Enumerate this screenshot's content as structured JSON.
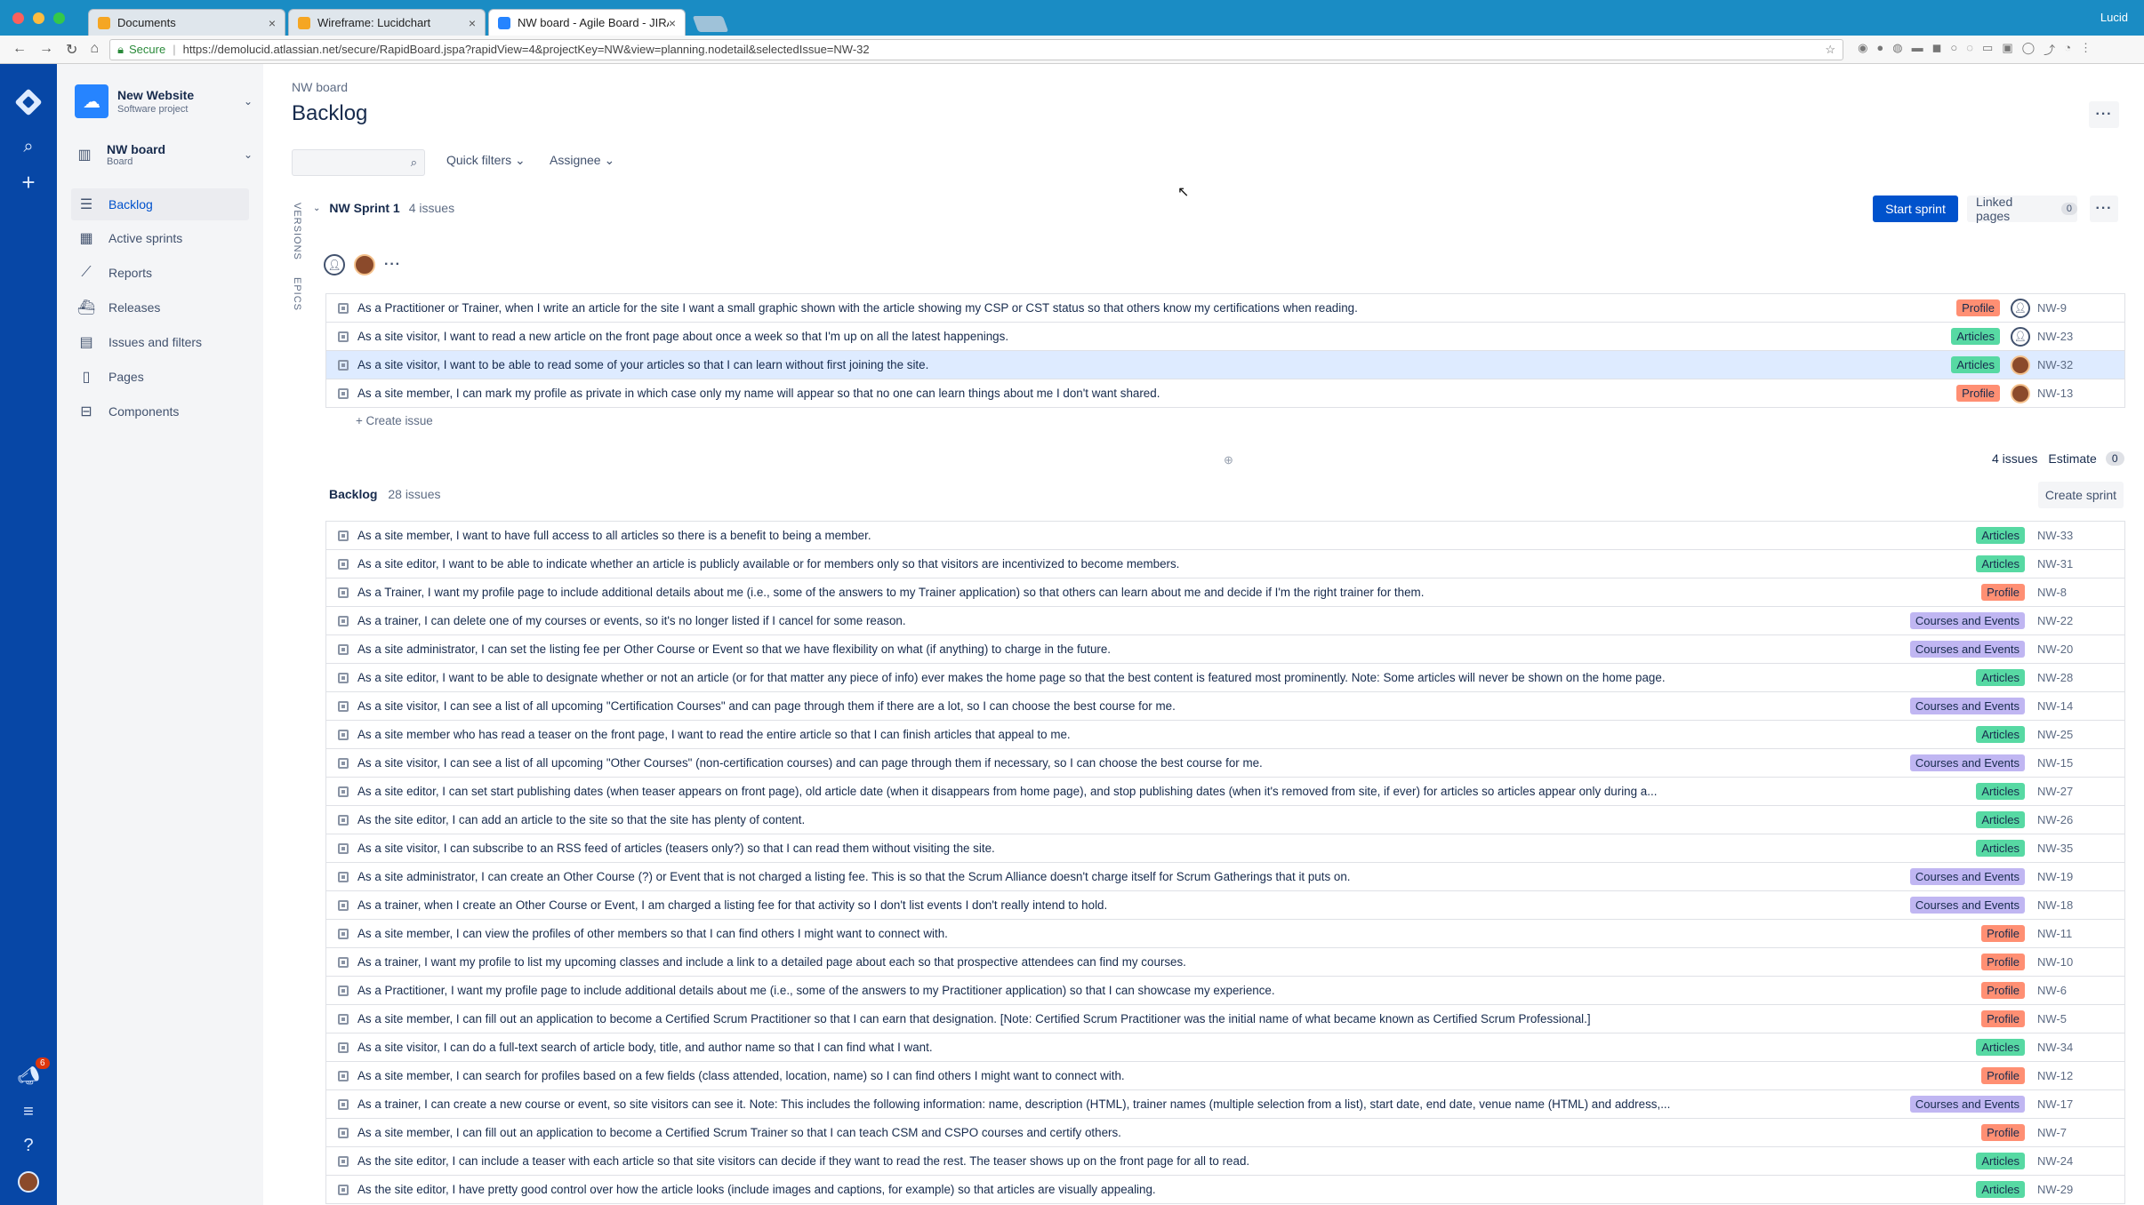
{
  "browser": {
    "tabs": [
      {
        "title": "Documents",
        "favicon_color": "#f5a623",
        "active": false
      },
      {
        "title": "Wireframe: Lucidchart",
        "favicon_color": "#f5a623",
        "active": false
      },
      {
        "title": "NW board - Agile Board - JIRA",
        "favicon_color": "#2684ff",
        "active": true
      }
    ],
    "profile": "Lucid",
    "secure_label": "Secure",
    "url": "https://demolucid.atlassian.net/secure/RapidBoard.jspa?rapidView=4&projectKey=NW&view=planning.nodetail&selectedIssue=NW-32"
  },
  "global_nav": {
    "notification_count": "6"
  },
  "project": {
    "name": "New Website",
    "type": "Software project",
    "board_name": "NW board",
    "board_type": "Board",
    "nav": [
      "Backlog",
      "Active sprints",
      "Reports",
      "Releases",
      "Issues and filters",
      "Pages",
      "Components"
    ]
  },
  "header": {
    "breadcrumb": "NW board",
    "title": "Backlog",
    "quick_filters": "Quick filters",
    "assignee": "Assignee"
  },
  "side_tabs": {
    "versions": "VERSIONS",
    "epics": "EPICS"
  },
  "sprint": {
    "name": "NW Sprint 1",
    "count": "4 issues",
    "start_label": "Start sprint",
    "linked_pages_label": "Linked pages",
    "linked_pages_count": "0",
    "create_issue": "+ Create issue",
    "summary_count": "4 issues",
    "estimate_label": "Estimate",
    "estimate_value": "0",
    "issues": [
      {
        "summary": "As a Practitioner or Trainer, when I write an article for the site I want a small graphic shown with the article showing my CSP or CST status so that others know my certifications when reading.",
        "epic": "Profile",
        "assignee": "user",
        "key": "NW-9"
      },
      {
        "summary": "As a site visitor, I want to read a new article on the front page about once a week so that I'm up on all the latest happenings.",
        "epic": "Articles",
        "assignee": "user",
        "key": "NW-23"
      },
      {
        "summary": "As a site visitor, I want to be able to read some of your articles so that I can learn without first joining the site.",
        "epic": "Articles",
        "assignee": "face",
        "key": "NW-32"
      },
      {
        "summary": "As a site member, I can mark my profile as private in which case only my name will appear so that no one can learn things about me I don't want shared.",
        "epic": "Profile",
        "assignee": "face",
        "key": "NW-13"
      }
    ]
  },
  "backlog": {
    "name": "Backlog",
    "count": "28 issues",
    "create_sprint_label": "Create sprint",
    "issues": [
      {
        "summary": "As a site member, I want to have full access to all articles so there is a benefit to being a member.",
        "epic": "Articles",
        "key": "NW-33"
      },
      {
        "summary": "As a site editor, I want to be able to indicate whether an article is publicly available or for members only so that visitors are incentivized to become members.",
        "epic": "Articles",
        "key": "NW-31"
      },
      {
        "summary": "As a Trainer, I want my profile page to include additional details about me (i.e., some of the answers to my Trainer application) so that others can learn about me and decide if I'm the right trainer for them.",
        "epic": "Profile",
        "key": "NW-8"
      },
      {
        "summary": "As a trainer, I can delete one of my courses or events, so it's no longer listed if I cancel for some reason.",
        "epic": "Courses and Events",
        "key": "NW-22"
      },
      {
        "summary": "As a site administrator, I can set the listing fee per Other Course or Event so that we have flexibility on what (if anything) to charge in the future.",
        "epic": "Courses and Events",
        "key": "NW-20"
      },
      {
        "summary": "As a site editor, I want to be able to designate whether or not an article (or for that matter any piece of info) ever makes the home page so that the best content is featured most prominently. Note: Some articles will never be shown on the home page.",
        "epic": "Articles",
        "key": "NW-28"
      },
      {
        "summary": "As a site visitor, I can see a list of all upcoming \"Certification Courses\" and can page through them if there are a lot, so I can choose the best course for me.",
        "epic": "Courses and Events",
        "key": "NW-14"
      },
      {
        "summary": "As a site member who has read a teaser on the front page, I want to read the entire article so that I can finish articles that appeal to me.",
        "epic": "Articles",
        "key": "NW-25"
      },
      {
        "summary": "As a site visitor, I can see a list of all upcoming \"Other Courses\" (non-certification courses) and can page through them if necessary, so I can choose the best course for me.",
        "epic": "Courses and Events",
        "key": "NW-15"
      },
      {
        "summary": "As a site editor, I can set start publishing dates (when teaser appears on front page), old article date (when it disappears from home page), and stop publishing dates (when it's removed from site, if ever) for articles so articles appear only during a...",
        "epic": "Articles",
        "key": "NW-27"
      },
      {
        "summary": "As the site editor, I can add an article to the site so that the site has plenty of content.",
        "epic": "Articles",
        "key": "NW-26"
      },
      {
        "summary": "As a site visitor, I can subscribe to an RSS feed of articles (teasers only?) so that I can read them without visiting the site.",
        "epic": "Articles",
        "key": "NW-35"
      },
      {
        "summary": "As a site administrator, I can create an Other Course (?) or Event that is not charged a listing fee. This is so that the Scrum Alliance doesn't charge itself for Scrum Gatherings that it puts on.",
        "epic": "Courses and Events",
        "key": "NW-19"
      },
      {
        "summary": "As a trainer, when I create an Other Course or Event, I am charged a listing fee for that activity so I don't list events I don't really intend to hold.",
        "epic": "Courses and Events",
        "key": "NW-18"
      },
      {
        "summary": "As a site member, I can view the profiles of other members so that I can find others I might want to connect with.",
        "epic": "Profile",
        "key": "NW-11"
      },
      {
        "summary": "As a trainer, I want my profile to list my upcoming classes and include a link to a detailed page about each so that prospective attendees can find my courses.",
        "epic": "Profile",
        "key": "NW-10"
      },
      {
        "summary": "As a Practitioner, I want my profile page to include additional details about me (i.e., some of the answers to my Practitioner application) so that I can showcase my experience.",
        "epic": "Profile",
        "key": "NW-6"
      },
      {
        "summary": "As a site member, I can fill out an application to become a Certified Scrum Practitioner so that I can earn that designation. [Note: Certified Scrum Practitioner was the initial name of what became known as Certified Scrum Professional.]",
        "epic": "Profile",
        "key": "NW-5"
      },
      {
        "summary": "As a site visitor, I can do a full-text search of article body, title, and author name so that I can find what I want.",
        "epic": "Articles",
        "key": "NW-34"
      },
      {
        "summary": "As a site member, I can search for profiles based on a few fields (class attended, location, name) so I can find others I might want to connect with.",
        "epic": "Profile",
        "key": "NW-12"
      },
      {
        "summary": "As a trainer, I can create a new course or event, so site visitors can see it. Note: This includes the following information: name, description (HTML), trainer names (multiple selection from a list), start date, end date, venue name (HTML) and address,...",
        "epic": "Courses and Events",
        "key": "NW-17"
      },
      {
        "summary": "As a site member, I can fill out an application to become a Certified Scrum Trainer so that I can teach CSM and CSPO courses and certify others.",
        "epic": "Profile",
        "key": "NW-7"
      },
      {
        "summary": "As the site editor, I can include a teaser with each article so that site visitors can decide if they want to read the rest. The teaser shows up on the front page for all to read.",
        "epic": "Articles",
        "key": "NW-24"
      },
      {
        "summary": "As the site editor, I have pretty good control over how the article looks (include images and captions, for example) so that articles are visually appealing.",
        "epic": "Articles",
        "key": "NW-29"
      }
    ]
  },
  "colors": {
    "global_nav": "#0747a6",
    "primary": "#0052cc",
    "articles": "#57d9a3",
    "profile": "#ff8f73",
    "courses": "#c0b6f2"
  }
}
